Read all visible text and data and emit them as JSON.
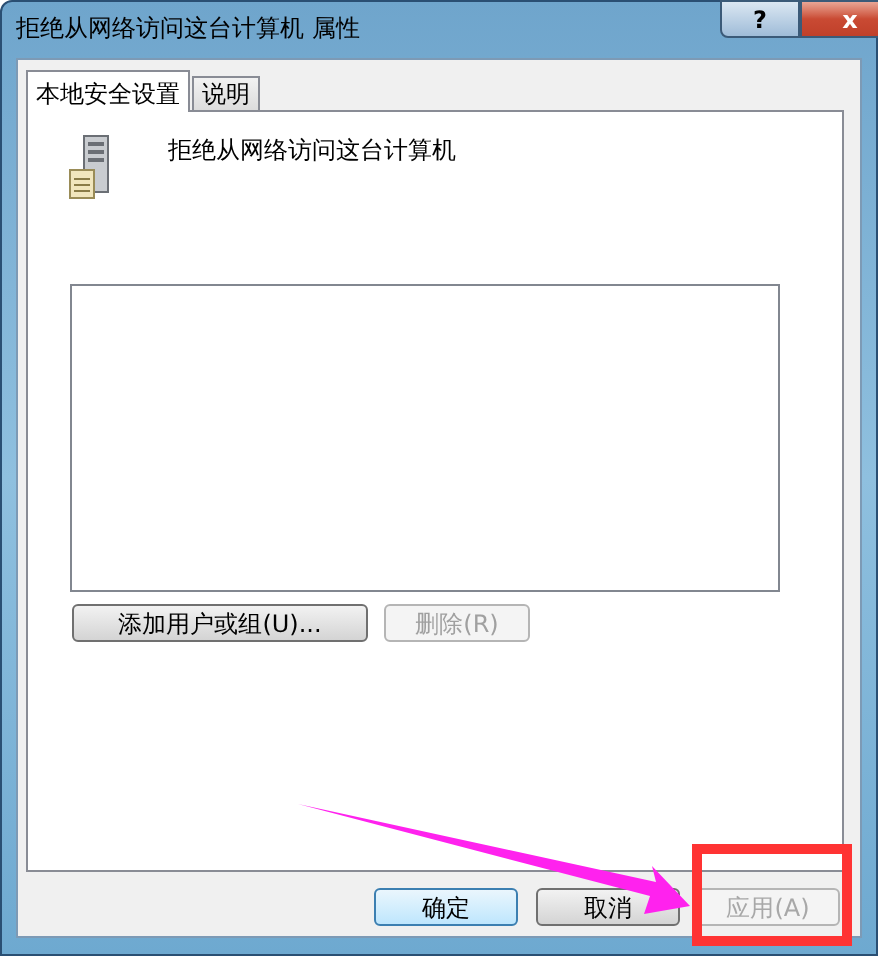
{
  "window": {
    "title": "拒绝从网络访问这台计算机 属性",
    "controls": [
      {
        "kind": "help",
        "label": "?"
      },
      {
        "kind": "close",
        "label": "x"
      }
    ]
  },
  "tabs": [
    {
      "label": "本地安全设置",
      "selected": true
    },
    {
      "label": "说明",
      "selected": false
    }
  ],
  "policy": {
    "name": "拒绝从网络访问这台计算机"
  },
  "list_buttons": [
    {
      "label": "添加用户或组(U)...",
      "disabled": false
    },
    {
      "label": "删除(R)",
      "disabled": true
    }
  ],
  "dialog_buttons": [
    {
      "label": "确定",
      "disabled": false,
      "default": true
    },
    {
      "label": "取消",
      "disabled": false,
      "default": false
    },
    {
      "label": "应用(A)",
      "disabled": true,
      "default": false
    }
  ],
  "annotations": [
    {
      "kind": "arrow",
      "color": "#ff22ee"
    },
    {
      "kind": "highlight",
      "color": "#ff3333"
    }
  ]
}
